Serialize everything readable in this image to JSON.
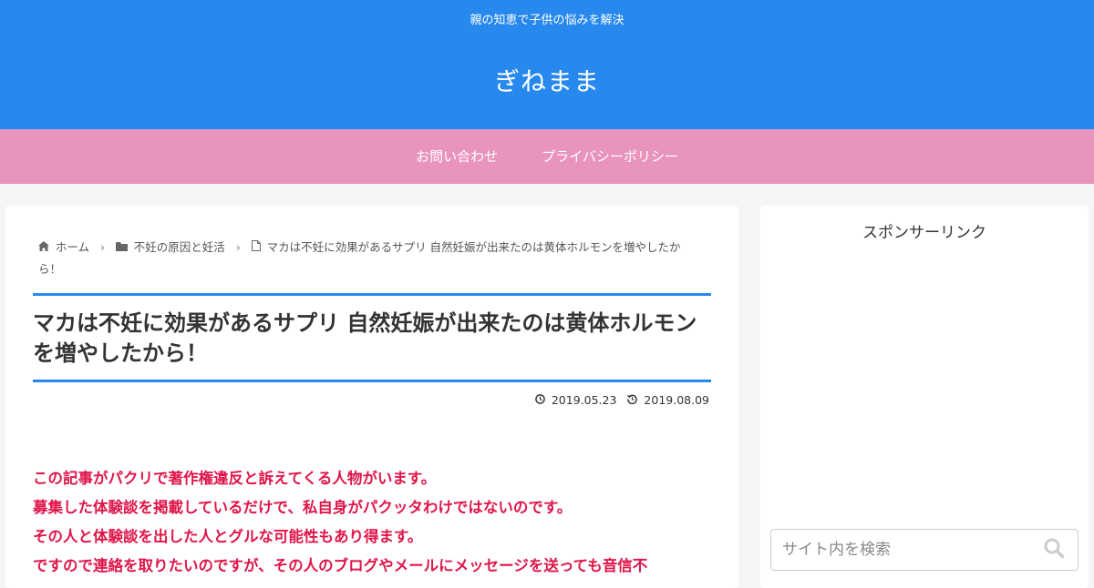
{
  "header": {
    "tagline": "親の知恵で子供の悩みを解決",
    "site_title": "ぎねまま"
  },
  "nav": {
    "items": [
      {
        "label": "お問い合わせ"
      },
      {
        "label": "プライバシーポリシー"
      }
    ]
  },
  "breadcrumb": {
    "home": "ホーム",
    "category": "不妊の原因と妊活",
    "current": "マカは不妊に効果があるサプリ 自然妊娠が出来たのは黄体ホルモンを増やしたから！"
  },
  "article": {
    "title": "マカは不妊に効果があるサプリ 自然妊娠が出来たのは黄体ホルモンを増やしたから！",
    "published": "2019.05.23",
    "updated": "2019.08.09",
    "lines": [
      "この記事がパクリで著作権違反と訴えてくる人物がいます。",
      "募集した体験談を掲載しているだけで、私自身がパクッタわけではないのです。",
      "その人と体験談を出した人とグルな可能性もあり得ます。",
      "ですので連絡を取りたいのですが、その人のブログやメールにメッセージを送っても音信不"
    ]
  },
  "sidebar": {
    "widget_title": "スポンサーリンク",
    "search_placeholder": "サイト内を検索"
  },
  "colors": {
    "header_blue": "#2788ed",
    "nav_pink": "#e994bf",
    "alert_red": "#e0164a"
  }
}
